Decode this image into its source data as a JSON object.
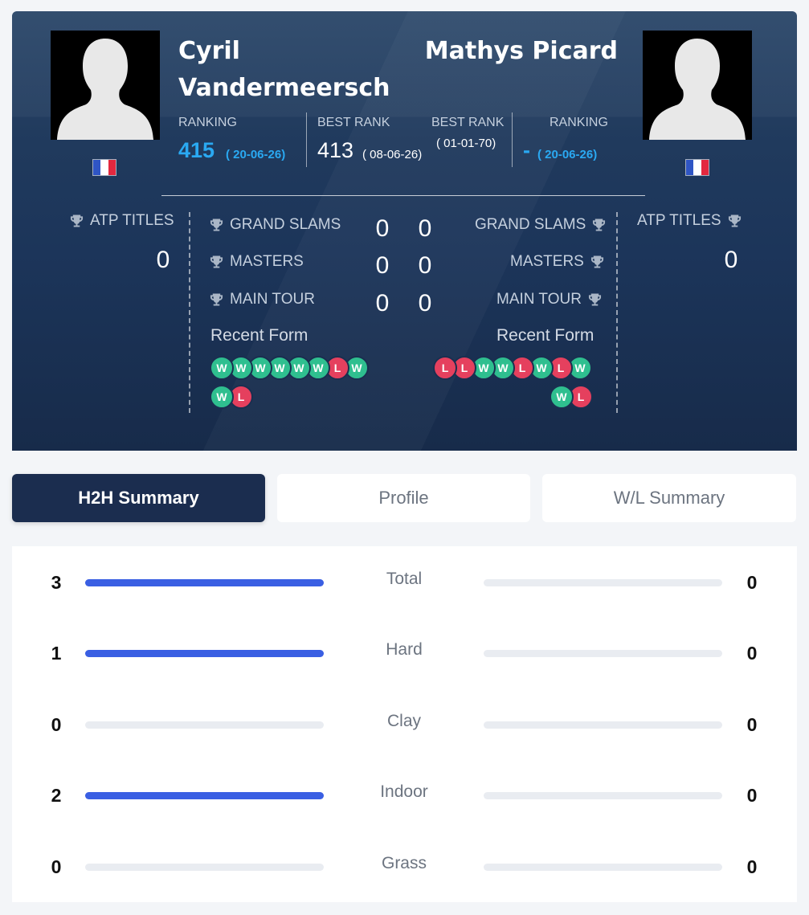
{
  "player1": {
    "name_line1": "Cyril",
    "name_line2": "Vandermeersch",
    "ranking_label": "RANKING",
    "ranking": "415",
    "ranking_date": "( 20-06-26)",
    "best_rank_label": "BEST RANK",
    "best_rank": "413",
    "best_rank_date": "( 08-06-26)",
    "atp_titles_label": "ATP TITLES",
    "atp_titles": "0",
    "grand_slams_label": "GRAND SLAMS",
    "grand_slams": "0",
    "masters_label": "MASTERS",
    "masters": "0",
    "main_tour_label": "MAIN TOUR",
    "main_tour": "0",
    "recent_form_label": "Recent Form",
    "recent_form": [
      "W",
      "W",
      "W",
      "W",
      "W",
      "W",
      "L",
      "W",
      "W",
      "L"
    ]
  },
  "player2": {
    "name": "Mathys Picard",
    "ranking_label": "RANKING",
    "ranking": "-",
    "ranking_date": "( 20-06-26)",
    "best_rank_label": "BEST RANK",
    "best_rank_date": "( 01-01-70)",
    "atp_titles_label": "ATP TITLES",
    "atp_titles": "0",
    "grand_slams_label": "GRAND SLAMS",
    "grand_slams": "0",
    "masters_label": "MASTERS",
    "masters": "0",
    "main_tour_label": "MAIN TOUR",
    "main_tour": "0",
    "recent_form_label": "Recent Form",
    "recent_form": [
      "L",
      "L",
      "W",
      "W",
      "L",
      "W",
      "L",
      "W",
      "W",
      "L"
    ]
  },
  "tabs": [
    {
      "label": "H2H Summary",
      "active": true
    },
    {
      "label": "Profile",
      "active": false
    },
    {
      "label": "W/L Summary",
      "active": false
    }
  ],
  "h2h": [
    {
      "label": "Total",
      "p1": "3",
      "p2": "0",
      "p1_fill": 1.0,
      "p2_fill": 0.0
    },
    {
      "label": "Hard",
      "p1": "1",
      "p2": "0",
      "p1_fill": 1.0,
      "p2_fill": 0.0
    },
    {
      "label": "Clay",
      "p1": "0",
      "p2": "0",
      "p1_fill": 0.0,
      "p2_fill": 0.0
    },
    {
      "label": "Indoor",
      "p1": "2",
      "p2": "0",
      "p1_fill": 1.0,
      "p2_fill": 0.0
    },
    {
      "label": "Grass",
      "p1": "0",
      "p2": "0",
      "p1_fill": 0.0,
      "p2_fill": 0.0
    }
  ],
  "colors": {
    "win": "#2fbf8f",
    "loss": "#e5405e",
    "bar_fill": "#3a5fe3",
    "ranking_accent": "#2aa9f2",
    "active_tab": "#1b2d4f"
  }
}
